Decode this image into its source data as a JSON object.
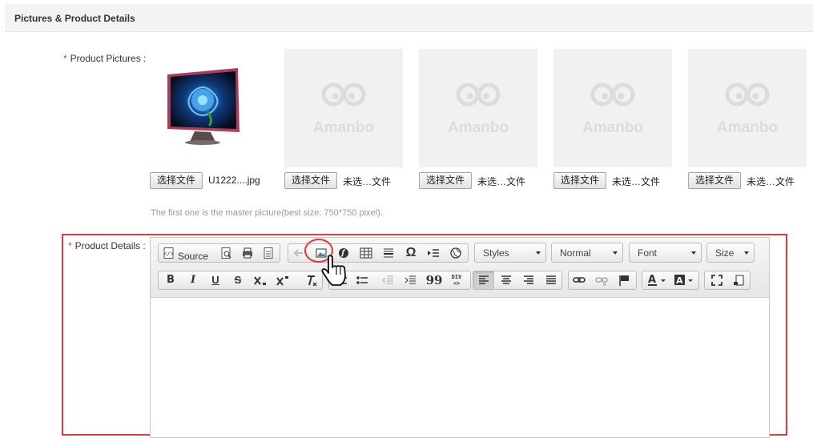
{
  "section": {
    "title": "Pictures & Product Details"
  },
  "pictures": {
    "required_mark": "*",
    "label": "Product Pictures :",
    "placeholder_brand": "Amanbo",
    "slots": [
      {
        "button": "选择文件",
        "file": "U1222....jpg"
      },
      {
        "button": "选择文件",
        "file": "未选…文件"
      },
      {
        "button": "选择文件",
        "file": "未选…文件"
      },
      {
        "button": "选择文件",
        "file": "未选…文件"
      },
      {
        "button": "选择文件",
        "file": "未选…文件"
      }
    ],
    "hint": "The first one is the master picture(best size: 750*750 pixel)."
  },
  "details": {
    "required_mark": "*",
    "label": "Product Details :",
    "toolbar": {
      "source_label": "Source",
      "styles": "Styles",
      "format": "Normal",
      "font": "Font",
      "size": "Size",
      "bold": "B",
      "italic": "I",
      "underline": "U",
      "strike": "S",
      "blockquote": "99",
      "div_line1": "DIV",
      "div_line2": "<>"
    }
  },
  "colors": {
    "accent_red": "#e03a3a",
    "header_bg": "#f3f3f3"
  }
}
